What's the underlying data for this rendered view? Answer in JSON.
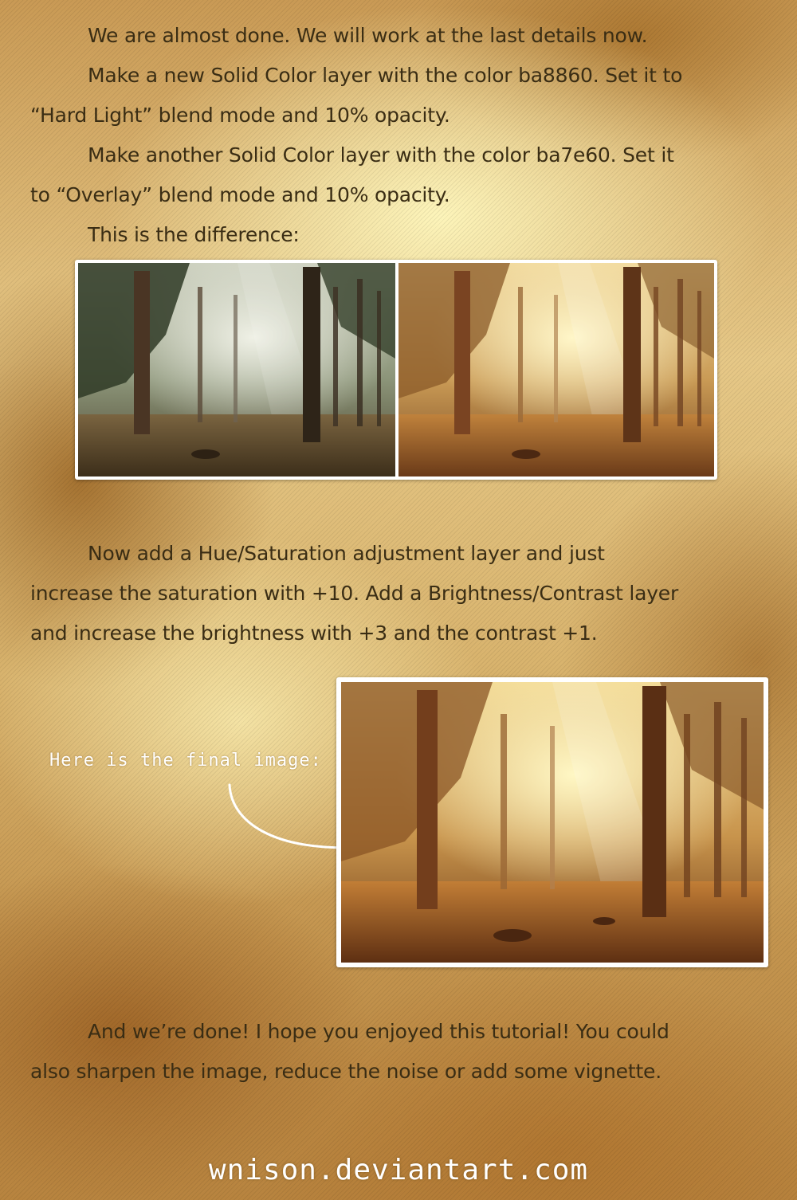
{
  "section1": {
    "lines": [
      "We are almost done. We will work at the last details now.",
      "Make a new Solid Color layer with the color ba8860. Set it to",
      "“Hard Light” blend mode and 10% opacity.",
      "Make another Solid Color layer with the color ba7e60. Set it",
      "to “Overlay” blend mode and 10% opacity.",
      "This is the difference:"
    ]
  },
  "section2": {
    "lines": [
      "Now add a Hue/Saturation adjustment layer and just",
      "increase the saturation with +10. Add a Brightness/Contrast layer",
      "and increase the brightness with +3 and the contrast +1."
    ]
  },
  "annotation": {
    "text": "Here is the final image:"
  },
  "section3": {
    "lines": [
      "And we’re done! I hope you enjoyed this tutorial! You could",
      "also sharpen the image, reduce the noise or add some vignette."
    ]
  },
  "footer": {
    "url": "wnison.deviantart.com"
  },
  "colors": {
    "text": "#3a2d14",
    "frame": "#ffffff",
    "before_tint": "#5b6a4e",
    "after_tint": "#d9a04a"
  }
}
